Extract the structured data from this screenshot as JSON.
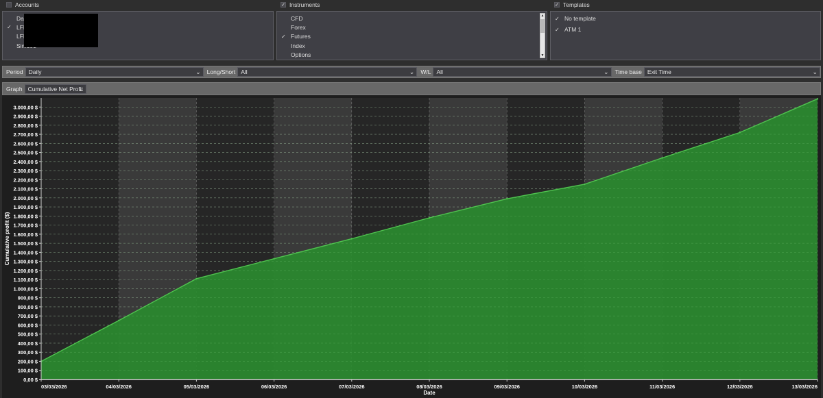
{
  "accounts": {
    "header": "Accounts",
    "header_checked": false,
    "items": [
      {
        "label": "Davi",
        "checked": false
      },
      {
        "label": "LFFC",
        "checked": true
      },
      {
        "label": "LFFC",
        "checked": false
      },
      {
        "label": "Sim101",
        "checked": false
      }
    ]
  },
  "instruments": {
    "header": "Instruments",
    "header_checked": true,
    "items": [
      {
        "label": "CFD",
        "checked": false
      },
      {
        "label": "Forex",
        "checked": false
      },
      {
        "label": "Futures",
        "checked": true
      },
      {
        "label": "Index",
        "checked": false
      },
      {
        "label": "Options",
        "checked": false
      }
    ]
  },
  "templates": {
    "header": "Templates",
    "header_checked": true,
    "items": [
      {
        "label": "No template",
        "checked": true
      },
      {
        "label": "ATM 1",
        "checked": true
      }
    ]
  },
  "filters": {
    "period_label": "Period",
    "period_value": "Daily",
    "longshort_label": "Long/Short",
    "longshort_value": "All",
    "wl_label": "W/L",
    "wl_value": "All",
    "timebase_label": "Time base",
    "timebase_value": "Exit Time"
  },
  "graph": {
    "label": "Graph",
    "value": "Cumulative Net Profit"
  },
  "colors": {
    "chart_bg_dark": "#262626",
    "chart_bg_band": "#3a3a3a",
    "area_fill": "#2a8a2f",
    "line": "#4fc34f",
    "axis_text": "#ffffff"
  },
  "chart_data": {
    "type": "area",
    "xlabel": "Date",
    "ylabel": "Cumulative profit ($)",
    "x": [
      "03/03/2026",
      "04/03/2026",
      "05/03/2026",
      "06/03/2026",
      "07/03/2026",
      "08/03/2026",
      "09/03/2026",
      "10/03/2026",
      "11/03/2026",
      "12/03/2026",
      "13/03/2026"
    ],
    "values": [
      200,
      650,
      1110,
      1330,
      1550,
      1780,
      1990,
      2150,
      2440,
      2720,
      3090
    ],
    "ylim": [
      0,
      3100
    ],
    "yticks": [
      0,
      100,
      200,
      300,
      400,
      500,
      600,
      700,
      800,
      900,
      1000,
      1100,
      1200,
      1300,
      1400,
      1500,
      1600,
      1700,
      1800,
      1900,
      2000,
      2100,
      2200,
      2300,
      2400,
      2500,
      2600,
      2700,
      2800,
      2900,
      3000
    ],
    "ytick_suffix": " $",
    "grid": true,
    "legend": "none"
  }
}
